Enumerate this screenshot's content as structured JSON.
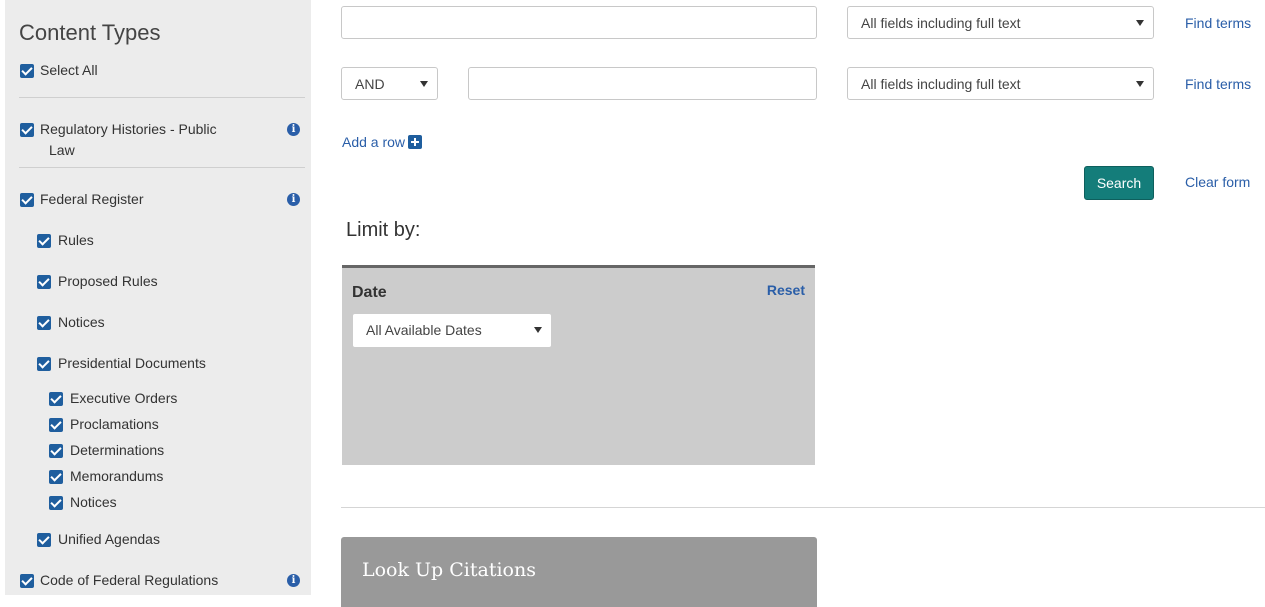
{
  "sidebar": {
    "title": "Content Types",
    "items": [
      {
        "label": "Select All"
      },
      {
        "label": "Regulatory Histories - Public"
      },
      {
        "label": "Law"
      },
      {
        "label": "Federal Register"
      },
      {
        "label": "Rules"
      },
      {
        "label": "Proposed Rules"
      },
      {
        "label": "Notices"
      },
      {
        "label": "Presidential Documents"
      },
      {
        "label": "Executive Orders"
      },
      {
        "label": "Proclamations"
      },
      {
        "label": "Determinations"
      },
      {
        "label": "Memorandums"
      },
      {
        "label": "Notices"
      },
      {
        "label": "Unified Agendas"
      },
      {
        "label": "Code of Federal Regulations"
      }
    ],
    "info_icon": "i"
  },
  "search": {
    "row1": {
      "value": "",
      "field": "All fields including full text",
      "find_terms": "Find terms"
    },
    "row2": {
      "operator": "AND",
      "value": "",
      "field": "All fields including full text",
      "find_terms": "Find terms"
    },
    "add_row": "Add a row",
    "search_label": "Search",
    "clear_label": "Clear form"
  },
  "limit": {
    "title": "Limit by:",
    "date": {
      "title": "Date",
      "reset": "Reset",
      "selected": "All Available Dates"
    }
  },
  "lookup": {
    "title": "Look Up Citations"
  },
  "colors": {
    "accent": "#147d7a",
    "link": "#2a5ea8",
    "checkbox": "#1f5e9e",
    "sidebar_bg": "#ececec"
  }
}
